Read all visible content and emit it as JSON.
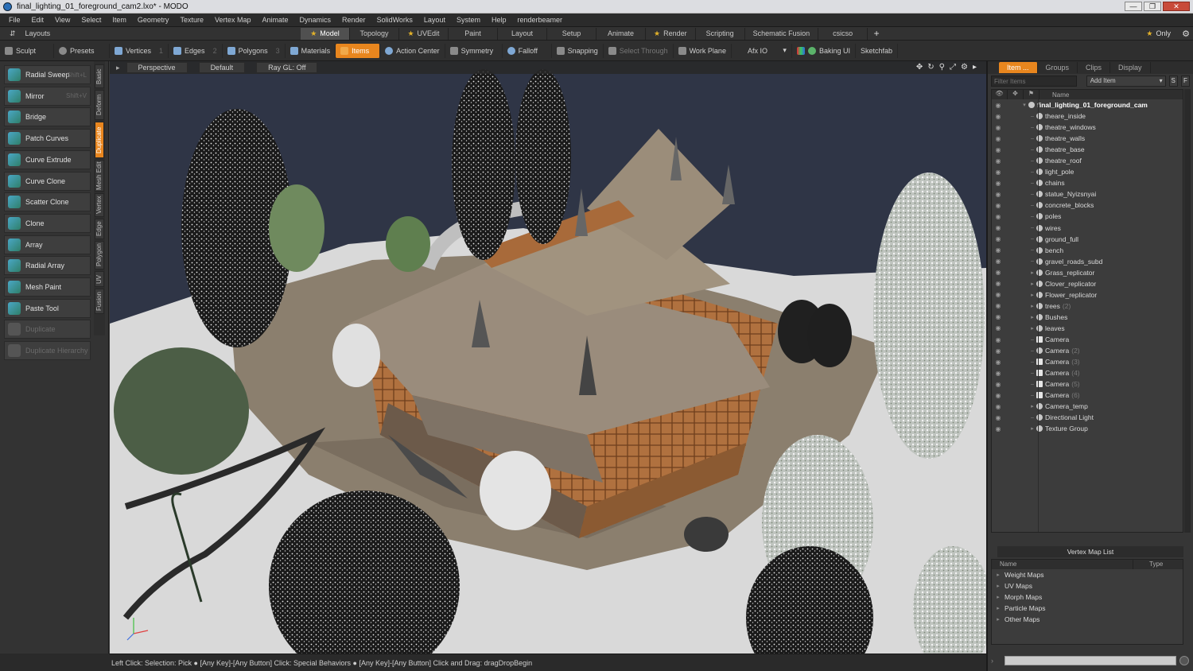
{
  "window": {
    "title": "final_lighting_01_foreground_cam2.lxo* - MODO",
    "buttons": [
      "—",
      "❐",
      "✕"
    ]
  },
  "menubar": {
    "items": [
      "File",
      "Edit",
      "View",
      "Select",
      "Item",
      "Geometry",
      "Texture",
      "Vertex Map",
      "Animate",
      "Dynamics",
      "Render",
      "SolidWorks",
      "Layout",
      "System",
      "Help",
      "renderbeamer"
    ]
  },
  "layoutbar": {
    "label": "Layouts",
    "tabs": [
      "Model",
      "Topology",
      "UVEdit",
      "Paint",
      "Layout",
      "Setup",
      "Animate",
      "Render",
      "Scripting",
      "Schematic Fusion",
      "csicso"
    ],
    "active_tab": "Model",
    "only_label": "Only"
  },
  "toolrow": {
    "sculpt": "Sculpt",
    "presets": "Presets",
    "vertices": "Vertices",
    "edges": "Edges",
    "polygons": "Polygons",
    "materials": "Materials",
    "items": "Items",
    "action_center": "Action Center",
    "symmetry": "Symmetry",
    "falloff": "Falloff",
    "snapping": "Snapping",
    "select_through": "Select Through",
    "work_plane": "Work Plane",
    "afx": "Afx IO",
    "baking": "Baking UI",
    "sketchfab": "Sketchfab",
    "vertices_count": "1",
    "edges_count": "2",
    "polygons_count": "3"
  },
  "leftpanel": {
    "tools": [
      {
        "label": "Radial Sweep",
        "shortcut": "Shift+L"
      },
      {
        "label": "Mirror",
        "shortcut": "Shift+V"
      },
      {
        "label": "Bridge",
        "shortcut": ""
      },
      {
        "label": "Patch Curves",
        "shortcut": ""
      },
      {
        "label": "Curve Extrude",
        "shortcut": ""
      },
      {
        "label": "Curve Clone",
        "shortcut": ""
      },
      {
        "label": "Scatter Clone",
        "shortcut": ""
      },
      {
        "label": "Clone",
        "shortcut": ""
      },
      {
        "label": "Array",
        "shortcut": ""
      },
      {
        "label": "Radial Array",
        "shortcut": ""
      },
      {
        "label": "Mesh Paint",
        "shortcut": ""
      },
      {
        "label": "Paste Tool",
        "shortcut": ""
      },
      {
        "label": "Duplicate",
        "shortcut": ""
      },
      {
        "label": "Duplicate Hierarchy",
        "shortcut": ""
      }
    ],
    "vtabs": [
      "Basic",
      "Deform",
      "Duplicate",
      "Mesh Edit",
      "Vertex",
      "Edge",
      "Polygon",
      "UV",
      "Fusion"
    ],
    "active_vtab": "Duplicate"
  },
  "viewport": {
    "view": "Perspective",
    "shading": "Default",
    "raygl": "Ray GL: Off"
  },
  "statusbar": {
    "text": "Left Click: Selection: Pick ● [Any Key]-[Any Button] Click: Special Behaviors ● [Any Key]-[Any Button] Click and Drag: dragDropBegin"
  },
  "rightpanel": {
    "tabs": [
      "Item ...",
      "Groups",
      "Clips",
      "Display"
    ],
    "active_tab": "Item ...",
    "filter_placeholder": "Filter Items",
    "add_item": "Add Item",
    "name_col": "Name",
    "items": [
      {
        "name": "final_lighting_01_foreground_cam",
        "level": 0,
        "root": true
      },
      {
        "name": "theare_inside",
        "level": 1
      },
      {
        "name": "theatre_windows",
        "level": 1
      },
      {
        "name": "theatre_walls",
        "level": 1
      },
      {
        "name": "theatre_base",
        "level": 1
      },
      {
        "name": "theatre_roof",
        "level": 1
      },
      {
        "name": "light_pole",
        "level": 1
      },
      {
        "name": "chains",
        "level": 1
      },
      {
        "name": "statue_Nyizsnyai",
        "level": 1
      },
      {
        "name": "concrete_blocks",
        "level": 1
      },
      {
        "name": "poles",
        "level": 1
      },
      {
        "name": "wires",
        "level": 1
      },
      {
        "name": "ground_full",
        "level": 1
      },
      {
        "name": "bench",
        "level": 1
      },
      {
        "name": "gravel_roads_subd",
        "level": 1
      },
      {
        "name": "Grass_replicator",
        "level": 1,
        "expandable": true
      },
      {
        "name": "Clover_replicator",
        "level": 1,
        "expandable": true
      },
      {
        "name": "Flower_replicator",
        "level": 1,
        "expandable": true
      },
      {
        "name": "trees",
        "suffix": "(2)",
        "level": 1,
        "expandable": true
      },
      {
        "name": "Bushes",
        "level": 1,
        "expandable": true
      },
      {
        "name": "leaves",
        "level": 1,
        "expandable": true
      },
      {
        "name": "Camera",
        "level": 1,
        "camera": true
      },
      {
        "name": "Camera",
        "suffix": "(2)",
        "level": 1
      },
      {
        "name": "Camera",
        "suffix": "(3)",
        "level": 1,
        "camera": true
      },
      {
        "name": "Camera",
        "suffix": "(4)",
        "level": 1,
        "camera": true
      },
      {
        "name": "Camera",
        "suffix": "(5)",
        "level": 1,
        "camera": true
      },
      {
        "name": "Camera",
        "suffix": "(6)",
        "level": 1,
        "camera": true
      },
      {
        "name": "Camera_temp",
        "level": 1,
        "expandable": true
      },
      {
        "name": "Directional Light",
        "level": 1
      },
      {
        "name": "Texture Group",
        "level": 1,
        "expandable": true
      }
    ],
    "vertex_map_title": "Vertex Map List",
    "vm_name_col": "Name",
    "vm_type_col": "Type",
    "vertex_maps": [
      "Weight Maps",
      "UV Maps",
      "Morph Maps",
      "Particle Maps",
      "Other Maps"
    ]
  },
  "colors": {
    "accent": "#e8861e",
    "sky": "#2f3546",
    "snow": "#dedede",
    "wood": "#a8683a",
    "roof": "#9a8c7c"
  }
}
